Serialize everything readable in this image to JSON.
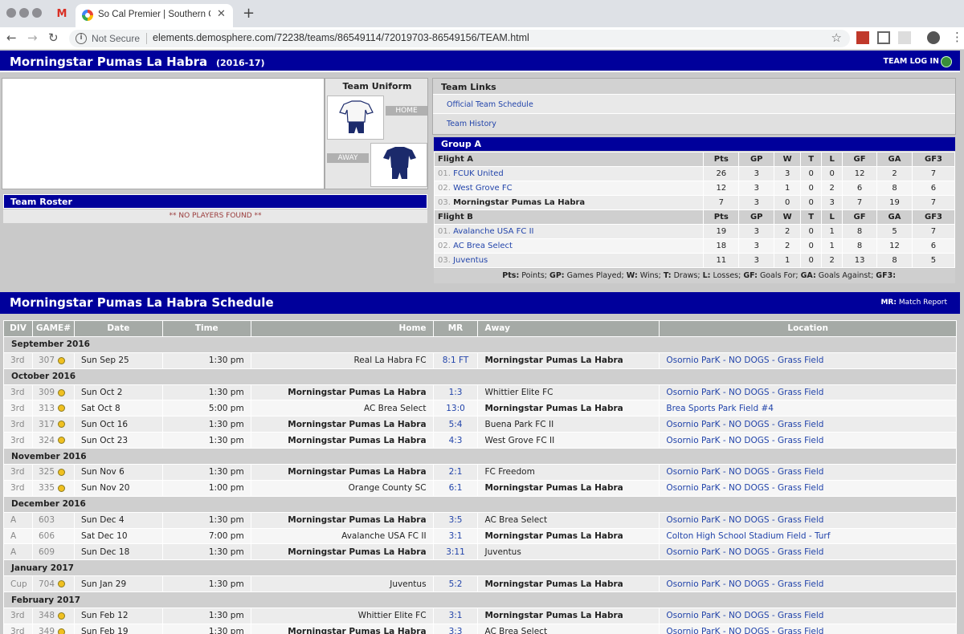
{
  "browser": {
    "tab_title": "So Cal Premier | Southern Cali",
    "security_label": "Not Secure",
    "url": "elements.demosphere.com/72238/teams/86549114/72019703-86549156/TEAM.html"
  },
  "header": {
    "team_name": "Morningstar Pumas La Habra",
    "season": "(2016-17)",
    "login_label": "TEAM LOG IN"
  },
  "uniform": {
    "title": "Team Uniform",
    "home_label": "HOME",
    "away_label": "AWAY"
  },
  "roster": {
    "title": "Team Roster",
    "empty_text": "** NO PLAYERS FOUND **"
  },
  "team_links": {
    "title": "Team Links",
    "items": [
      "Official Team Schedule",
      "Team History"
    ]
  },
  "standings": {
    "group_title": "Group A",
    "columns": [
      "Pts",
      "GP",
      "W",
      "T",
      "L",
      "GF",
      "GA",
      "GF3"
    ],
    "flights": [
      {
        "name": "Flight A",
        "rows": [
          {
            "rank": "01.",
            "team": "FCUK United",
            "vals": [
              "26",
              "3",
              "3",
              "0",
              "0",
              "12",
              "2",
              "7"
            ]
          },
          {
            "rank": "02.",
            "team": "West Grove FC",
            "vals": [
              "12",
              "3",
              "1",
              "0",
              "2",
              "6",
              "8",
              "6"
            ]
          },
          {
            "rank": "03.",
            "team": "Morningstar Pumas La Habra",
            "vals": [
              "7",
              "3",
              "0",
              "0",
              "3",
              "7",
              "19",
              "7"
            ]
          }
        ]
      },
      {
        "name": "Flight B",
        "rows": [
          {
            "rank": "01.",
            "team": "Avalanche USA FC II",
            "vals": [
              "19",
              "3",
              "2",
              "0",
              "1",
              "8",
              "5",
              "7"
            ]
          },
          {
            "rank": "02.",
            "team": "AC Brea Select",
            "vals": [
              "18",
              "3",
              "2",
              "0",
              "1",
              "8",
              "12",
              "6"
            ]
          },
          {
            "rank": "03.",
            "team": "Juventus",
            "vals": [
              "11",
              "3",
              "1",
              "0",
              "2",
              "13",
              "8",
              "5"
            ]
          }
        ]
      }
    ],
    "legend_html": "<b>Pts:</b> Points; <b>GP:</b> Games Played; <b>W:</b> Wins; <b>T:</b> Draws; <b>L:</b> Losses; <b>GF:</b> Goals For; <b>GA:</b> Goals Against; <b>GF3:</b>"
  },
  "schedule": {
    "title": "Morningstar Pumas La Habra Schedule",
    "mr_note_key": "MR:",
    "mr_note_val": "Match Report",
    "columns": [
      "DIV",
      "GAME#",
      "Date",
      "Time",
      "Home",
      "MR",
      "Away",
      "Location"
    ],
    "months": [
      {
        "label": "September 2016",
        "games": [
          {
            "div": "3rd",
            "game": "307",
            "ball": true,
            "date": "Sun Sep 25",
            "time": "1:30 pm",
            "home": "Real La Habra FC",
            "mr": "8:1 FT",
            "away": "Morningstar Pumas La Habra",
            "loc": "Osornio ParK - NO DOGS - Grass Field",
            "homeBold": false
          }
        ]
      },
      {
        "label": "October 2016",
        "games": [
          {
            "div": "3rd",
            "game": "309",
            "ball": true,
            "date": "Sun Oct 2",
            "time": "1:30 pm",
            "home": "Morningstar Pumas La Habra",
            "mr": "1:3",
            "away": "Whittier Elite FC",
            "loc": "Osornio ParK - NO DOGS - Grass Field",
            "homeBold": true
          },
          {
            "div": "3rd",
            "game": "313",
            "ball": true,
            "date": "Sat Oct 8",
            "time": "5:00 pm",
            "home": "AC Brea Select",
            "mr": "13:0",
            "away": "Morningstar Pumas La Habra",
            "loc": "Brea Sports Park Field #4",
            "homeBold": false
          },
          {
            "div": "3rd",
            "game": "317",
            "ball": true,
            "date": "Sun Oct 16",
            "time": "1:30 pm",
            "home": "Morningstar Pumas La Habra",
            "mr": "5:4",
            "away": "Buena Park FC II",
            "loc": "Osornio ParK - NO DOGS - Grass Field",
            "homeBold": true
          },
          {
            "div": "3rd",
            "game": "324",
            "ball": true,
            "date": "Sun Oct 23",
            "time": "1:30 pm",
            "home": "Morningstar Pumas La Habra",
            "mr": "4:3",
            "away": "West Grove FC II",
            "loc": "Osornio ParK - NO DOGS - Grass Field",
            "homeBold": true
          }
        ]
      },
      {
        "label": "November 2016",
        "games": [
          {
            "div": "3rd",
            "game": "325",
            "ball": true,
            "date": "Sun Nov 6",
            "time": "1:30 pm",
            "home": "Morningstar Pumas La Habra",
            "mr": "2:1",
            "away": "FC Freedom",
            "loc": "Osornio ParK - NO DOGS - Grass Field",
            "homeBold": true
          },
          {
            "div": "3rd",
            "game": "335",
            "ball": true,
            "date": "Sun Nov 20",
            "time": "1:00 pm",
            "home": "Orange County SC",
            "mr": "6:1",
            "away": "Morningstar Pumas La Habra",
            "loc": "Osornio ParK - NO DOGS - Grass Field",
            "homeBold": false
          }
        ]
      },
      {
        "label": "December 2016",
        "games": [
          {
            "div": "A",
            "game": "603",
            "ball": false,
            "date": "Sun Dec 4",
            "time": "1:30 pm",
            "home": "Morningstar Pumas La Habra",
            "mr": "3:5",
            "away": "AC Brea Select",
            "loc": "Osornio ParK - NO DOGS - Grass Field",
            "homeBold": true
          },
          {
            "div": "A",
            "game": "606",
            "ball": false,
            "date": "Sat Dec 10",
            "time": "7:00 pm",
            "home": "Avalanche USA FC II",
            "mr": "3:1",
            "away": "Morningstar Pumas La Habra",
            "loc": "Colton High School Stadium Field - Turf",
            "homeBold": false
          },
          {
            "div": "A",
            "game": "609",
            "ball": false,
            "date": "Sun Dec 18",
            "time": "1:30 pm",
            "home": "Morningstar Pumas La Habra",
            "mr": "3:11",
            "away": "Juventus",
            "loc": "Osornio ParK - NO DOGS - Grass Field",
            "homeBold": true
          }
        ]
      },
      {
        "label": "January 2017",
        "games": [
          {
            "div": "Cup",
            "game": "704",
            "ball": true,
            "date": "Sun Jan 29",
            "time": "1:30 pm",
            "home": "Juventus",
            "mr": "5:2",
            "away": "Morningstar Pumas La Habra",
            "loc": "Osornio ParK - NO DOGS - Grass Field",
            "homeBold": false
          }
        ]
      },
      {
        "label": "February 2017",
        "games": [
          {
            "div": "3rd",
            "game": "348",
            "ball": true,
            "date": "Sun Feb 12",
            "time": "1:30 pm",
            "home": "Whittier Elite FC",
            "mr": "3:1",
            "away": "Morningstar Pumas La Habra",
            "loc": "Osornio ParK - NO DOGS - Grass Field",
            "homeBold": false
          },
          {
            "div": "3rd",
            "game": "349",
            "ball": true,
            "date": "Sun Feb 19",
            "time": "1:30 pm",
            "home": "Morningstar Pumas La Habra",
            "mr": "3:3",
            "away": "AC Brea Select",
            "loc": "Osornio ParK - NO DOGS - Grass Field",
            "homeBold": true
          }
        ]
      }
    ]
  }
}
